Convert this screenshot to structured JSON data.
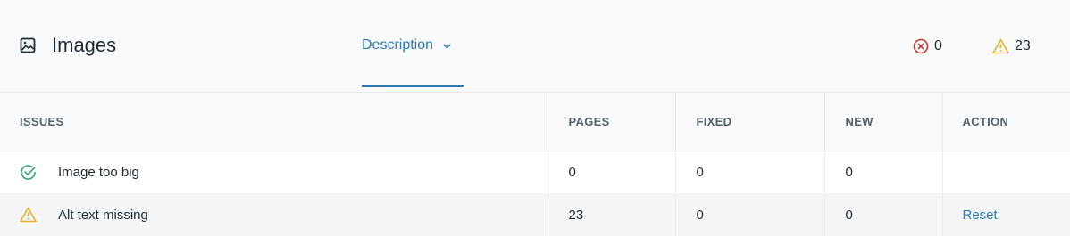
{
  "header": {
    "title": "Images",
    "tab_label": "Description",
    "error_count": "0",
    "warning_count": "23",
    "icons": {
      "title": "image-icon",
      "tab": "chevron-down-icon",
      "error": "x-circle-icon",
      "warning": "warning-triangle-icon"
    }
  },
  "table": {
    "columns": [
      "ISSUES",
      "PAGES",
      "FIXED",
      "NEW",
      "ACTION"
    ],
    "rows": [
      {
        "status_icon": "check-circle-icon",
        "issue": "Image too big",
        "pages": "0",
        "fixed": "0",
        "new": "0",
        "action": ""
      },
      {
        "status_icon": "warning-triangle-icon",
        "issue": "Alt text missing",
        "pages": "23",
        "fixed": "0",
        "new": "0",
        "action": "Reset"
      }
    ]
  },
  "colors": {
    "accent": "#2e7ab0",
    "error": "#c0392b",
    "warning": "#e6b325",
    "success": "#3ba776"
  }
}
